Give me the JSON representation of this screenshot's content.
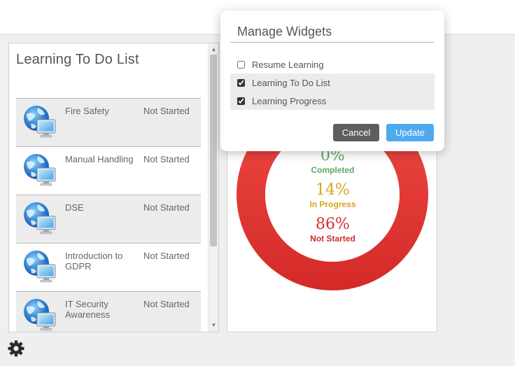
{
  "todo": {
    "title": "Learning To Do List",
    "items": [
      {
        "name": "Fire Safety",
        "status": "Not Started"
      },
      {
        "name": "Manual Handling",
        "status": "Not Started"
      },
      {
        "name": "DSE",
        "status": "Not Started"
      },
      {
        "name": "Introduction to GDPR",
        "status": "Not Started"
      },
      {
        "name": "IT Security Awareness",
        "status": "Not Started"
      }
    ]
  },
  "progress": {
    "completed_pct": "0%",
    "completed_label": "Completed",
    "in_progress_pct": "14%",
    "in_progress_label": "In Progress",
    "not_started_pct": "86%",
    "not_started_label": "Not Started",
    "fractions": {
      "completed": 0,
      "in_progress": 0.14,
      "not_started": 0.86
    },
    "colors": {
      "completed": "#5aaa64",
      "in_progress": "#d8a41c",
      "not_started": "#e0312f"
    }
  },
  "popup": {
    "title": "Manage Widgets",
    "options": [
      {
        "label": "Resume Learning",
        "checked": false
      },
      {
        "label": "Learning To Do List",
        "checked": true
      },
      {
        "label": "Learning Progress",
        "checked": true
      }
    ],
    "cancel_label": "Cancel",
    "update_label": "Update"
  },
  "icons": {
    "course": "globe-computer-icon",
    "settings": "gear-icon"
  }
}
